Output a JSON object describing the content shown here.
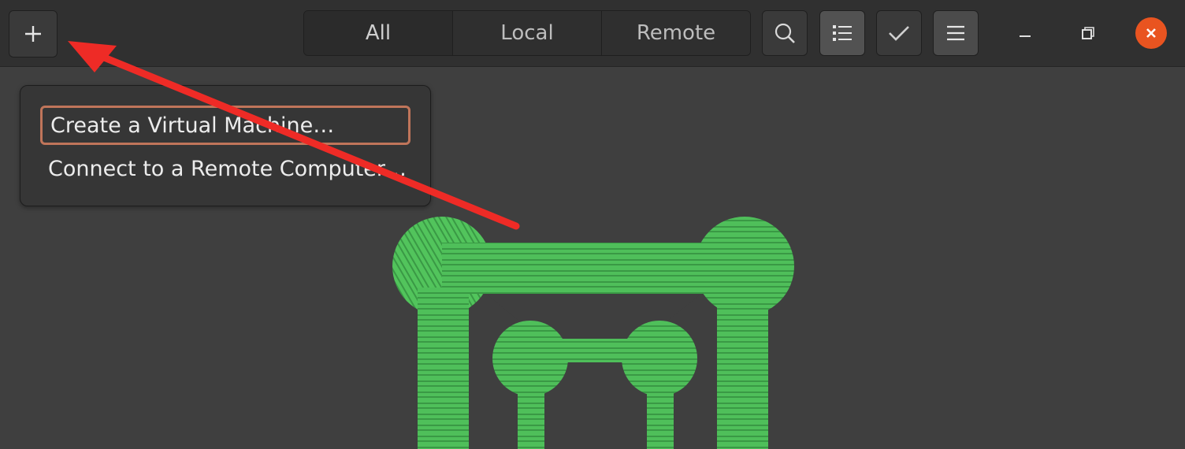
{
  "header": {
    "tabs": [
      {
        "label": "All",
        "selected": true
      },
      {
        "label": "Local",
        "selected": false
      },
      {
        "label": "Remote",
        "selected": false
      }
    ],
    "icons": {
      "new": "plus-icon",
      "search": "search-icon",
      "view": "list-view-icon",
      "select": "checkmark-icon",
      "menu": "hamburger-menu-icon",
      "minimize": "minimize-icon",
      "maximize": "maximize-icon",
      "close": "close-icon"
    }
  },
  "popover": {
    "items": [
      {
        "label": "Create a Virtual Machine…",
        "focused": true
      },
      {
        "label": "Connect to a Remote Computer…",
        "focused": false
      }
    ]
  },
  "colors": {
    "accent": "#e95420",
    "focus_ring": "#c0755a",
    "annotation": "#ee2b26",
    "logo_green": "#4fbf5a"
  }
}
